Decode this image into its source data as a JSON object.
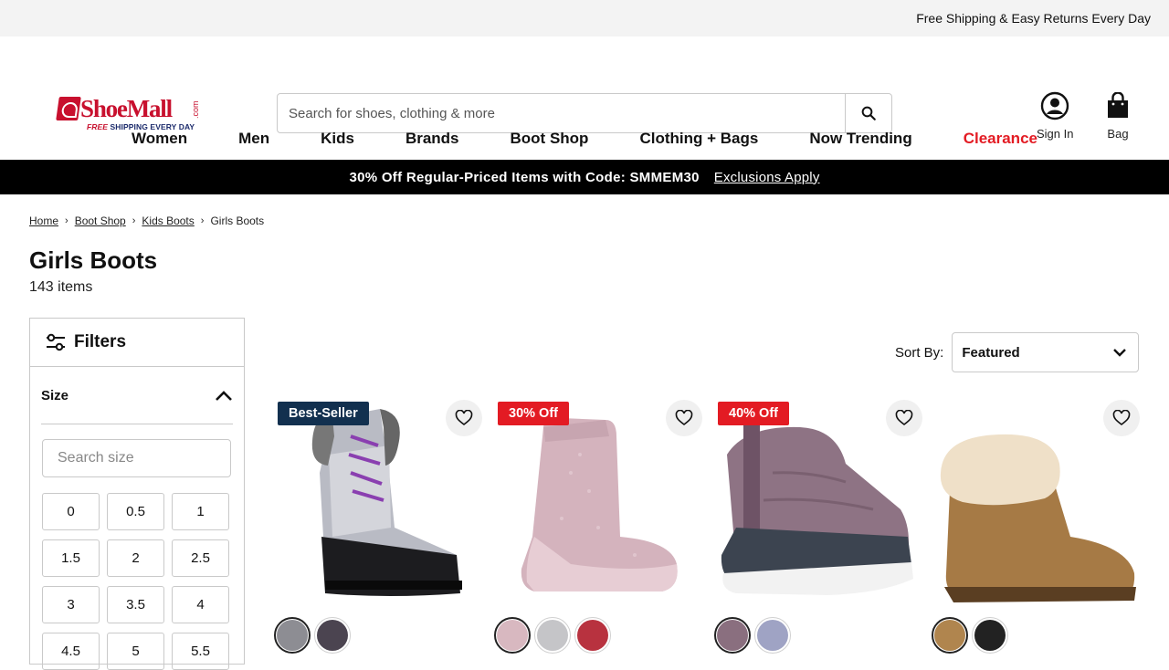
{
  "topbar": {
    "message": "Free Shipping & Easy Returns Every Day"
  },
  "logo": {
    "name": "ShoeMall",
    "com": ".com",
    "tag_free": "FREE",
    "tag_rest": " SHIPPING EVERY DAY"
  },
  "search": {
    "placeholder": "Search for shoes, clothing & more"
  },
  "header": {
    "sign_in": "Sign In",
    "bag": "Bag"
  },
  "nav": {
    "items": [
      "Women",
      "Men",
      "Kids",
      "Brands",
      "Boot Shop",
      "Clothing + Bags",
      "Now Trending"
    ],
    "clearance": "Clearance"
  },
  "promo": {
    "text": "30% Off Regular-Priced Items with Code: SMMEM30",
    "link": "Exclusions Apply"
  },
  "breadcrumb": {
    "items": [
      "Home",
      "Boot Shop",
      "Kids Boots"
    ],
    "current": "Girls Boots"
  },
  "page": {
    "title": "Girls Boots",
    "count": "143 items"
  },
  "filters": {
    "title": "Filters",
    "size_title": "Size",
    "size_search_placeholder": "Search size",
    "sizes": [
      "0",
      "0.5",
      "1",
      "1.5",
      "2",
      "2.5",
      "3",
      "3.5",
      "4",
      "4.5",
      "5",
      "5.5"
    ]
  },
  "sort": {
    "label": "Sort By:",
    "value": "Featured"
  },
  "products": [
    {
      "badge": "Best-Seller",
      "badge_style": "dark",
      "swatches": [
        "#8d8d93",
        "#4b4450"
      ]
    },
    {
      "badge": "30% Off",
      "badge_style": "red",
      "swatches": [
        "#d8b8c0",
        "#c5c5c8",
        "#b8323f"
      ]
    },
    {
      "badge": "40% Off",
      "badge_style": "red",
      "swatches": [
        "#8a6f7f",
        "#9fa3c4"
      ]
    },
    {
      "badge": "",
      "badge_style": "",
      "swatches": [
        "#b0854e",
        "#222222"
      ]
    }
  ],
  "colors": {
    "accent_red": "#e31b23",
    "badge_dark": "#12304f",
    "promo_bg": "#000000",
    "topbar_bg": "#f3f3f3"
  }
}
